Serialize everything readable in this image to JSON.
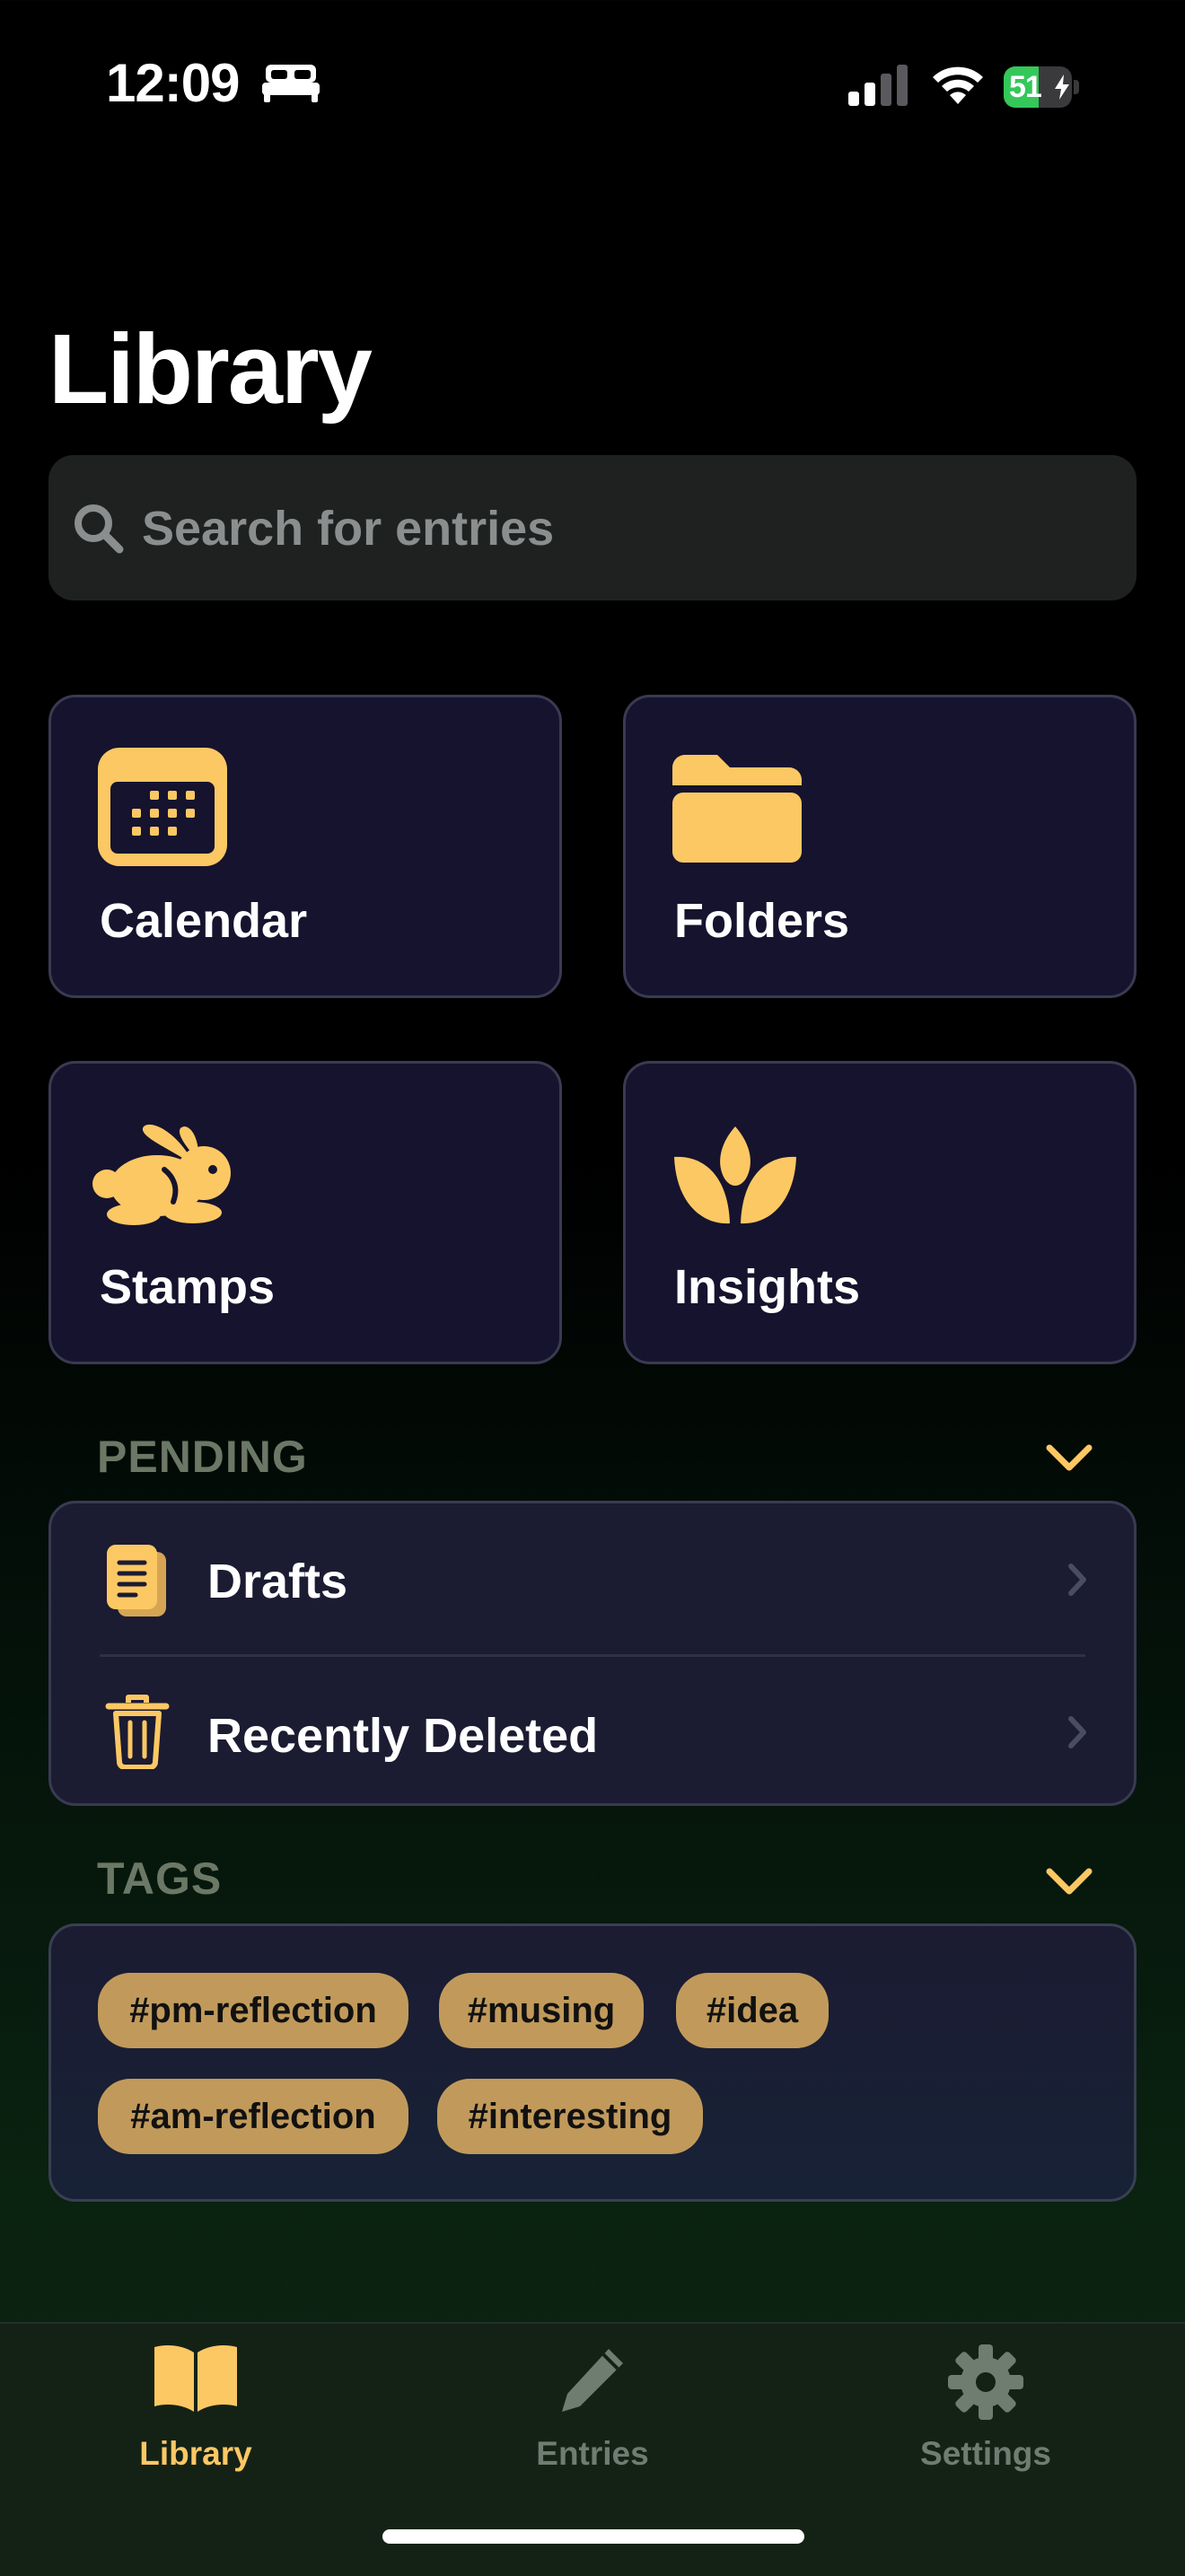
{
  "status_bar": {
    "time": "12:09",
    "battery_percent": "51",
    "battery_level": 0.51,
    "sleep_icon": "bed-icon",
    "signal_icon": "cellular-signal-icon",
    "wifi_icon": "wifi-icon",
    "charging_icon": "bolt-icon"
  },
  "page": {
    "title": "Library"
  },
  "search": {
    "placeholder": "Search for entries",
    "value": "",
    "icon": "magnifying-glass-icon"
  },
  "cards": [
    {
      "label": "Calendar",
      "icon": "calendar-icon"
    },
    {
      "label": "Folders",
      "icon": "folder-icon"
    },
    {
      "label": "Stamps",
      "icon": "rabbit-icon"
    },
    {
      "label": "Insights",
      "icon": "lotus-leaf-icon"
    }
  ],
  "pending": {
    "header": "PENDING",
    "items": [
      {
        "label": "Drafts",
        "icon": "document-stack-icon"
      },
      {
        "label": "Recently Deleted",
        "icon": "trash-icon"
      }
    ]
  },
  "tags": {
    "header": "TAGS",
    "items": [
      "#pm-reflection",
      "#musing",
      "#idea",
      "#am-reflection",
      "#interesting"
    ]
  },
  "tab_bar": {
    "tabs": [
      {
        "label": "Library",
        "icon": "open-book-icon",
        "active": true
      },
      {
        "label": "Entries",
        "icon": "pencil-icon",
        "active": false
      },
      {
        "label": "Settings",
        "icon": "gear-icon",
        "active": false
      }
    ]
  },
  "colors": {
    "accent": "#fcc864",
    "card_background": "#16132e",
    "tag_background": "#c19a5b",
    "section_header": "#6c7866",
    "inactive_tab": "#6e7d70",
    "battery_green": "#34c759"
  }
}
